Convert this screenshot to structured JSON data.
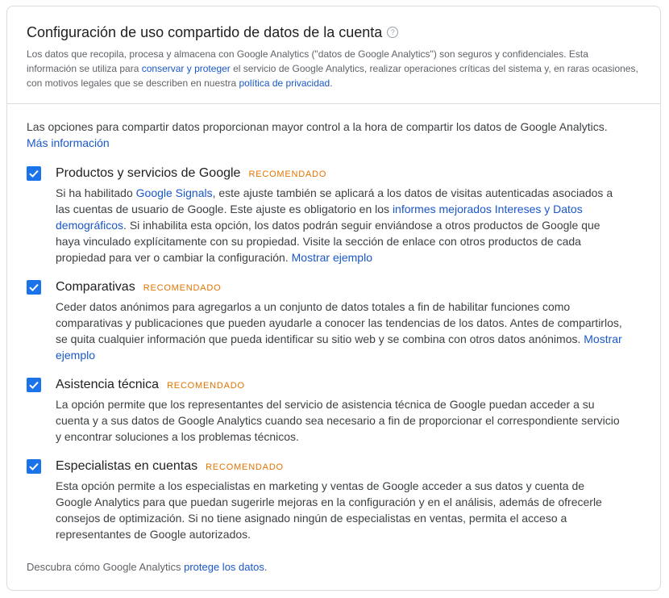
{
  "header": {
    "title": "Configuración de uso compartido de datos de la cuenta",
    "help_glyph": "?",
    "desc_part1": "Los datos que recopila, procesa y almacena con Google Analytics (\"datos de Google Analytics\") son seguros y confidenciales. Esta información se utiliza para ",
    "desc_link1": "conservar y proteger",
    "desc_part2": " el servicio de Google Analytics, realizar operaciones críticas del sistema y, en raras ocasiones, con motivos legales que se describen en nuestra ",
    "desc_link2": "política de privacidad",
    "desc_part3": "."
  },
  "intro": {
    "text": "Las opciones para compartir datos proporcionan mayor control a la hora de compartir los datos de Google Analytics.",
    "link": "Más información"
  },
  "badge_label": "RECOMENDADO",
  "options": [
    {
      "title": "Productos y servicios de Google",
      "checked": true,
      "desc_a": "Si ha habilitado ",
      "link_a": "Google Signals",
      "desc_b": ", este ajuste también se aplicará a los datos de visitas autenticadas asociados a las cuentas de usuario de Google. Este ajuste es obligatorio en los ",
      "link_b": "informes mejorados Intereses y Datos demográficos",
      "desc_c": ". Si inhabilita esta opción, los datos podrán seguir enviándose a otros productos de Google que haya vinculado explícitamente con su propiedad. Visite la sección de enlace con otros productos de cada propiedad para ver o cambiar la configuración. ",
      "link_c": "Mostrar ejemplo"
    },
    {
      "title": "Comparativas",
      "checked": true,
      "desc": "Ceder datos anónimos para agregarlos a un conjunto de datos totales a fin de habilitar funciones como comparativas y publicaciones que pueden ayudarle a conocer las tendencias de los datos. Antes de compartirlos, se quita cualquier información que pueda identificar su sitio web y se combina con otros datos anónimos. ",
      "link": "Mostrar ejemplo"
    },
    {
      "title": "Asistencia técnica",
      "checked": true,
      "desc": "La opción permite que los representantes del servicio de asistencia técnica de Google puedan acceder a su cuenta y a sus datos de Google Analytics cuando sea necesario a fin de proporcionar el correspondiente servicio y encontrar soluciones a los problemas técnicos."
    },
    {
      "title": "Especialistas en cuentas",
      "checked": true,
      "desc": "Esta opción permite a los especialistas en marketing y ventas de Google acceder a sus datos y cuenta de Google Analytics para que puedan sugerirle mejoras en la configuración y en el análisis, además de ofrecerle consejos de optimización. Si no tiene asignado ningún de especialistas en ventas, permita el acceso a representantes de Google autorizados."
    }
  ],
  "footer": {
    "text": "Descubra cómo Google Analytics ",
    "link": "protege los datos",
    "end": "."
  },
  "colors": {
    "checkbox": "#1a73e8",
    "badge": "#e37400",
    "link": "#1a57c9"
  }
}
